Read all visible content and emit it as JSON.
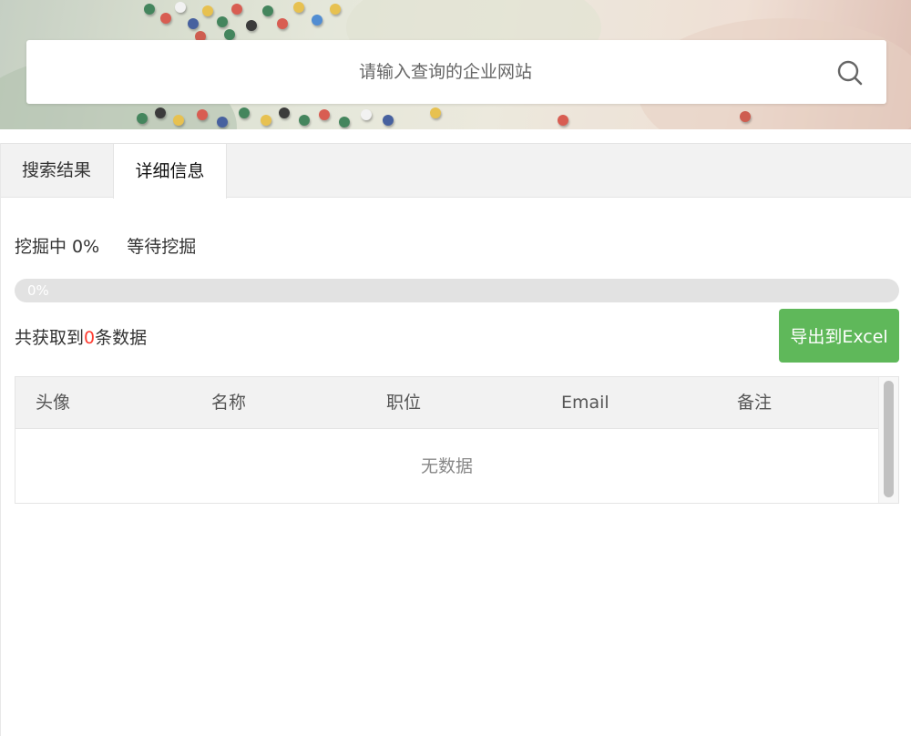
{
  "search": {
    "placeholder": "请输入查询的企业网站",
    "icon": "search-icon"
  },
  "tabs": [
    {
      "label": "搜索结果",
      "active": false
    },
    {
      "label": "详细信息",
      "active": true
    }
  ],
  "status": {
    "mining_label": "挖掘中 0%",
    "waiting_label": "等待挖掘"
  },
  "progress": {
    "value": 0,
    "label": "0%"
  },
  "summary": {
    "prefix": "共获取到",
    "count": "0",
    "suffix": "条数据"
  },
  "export": {
    "label": "导出到Excel"
  },
  "table": {
    "columns": [
      "头像",
      "名称",
      "职位",
      "Email",
      "备注"
    ],
    "rows": [],
    "empty_text": "无数据"
  },
  "colors": {
    "accent_green": "#5fb85a",
    "count_red": "#ff3b30",
    "tab_bar_bg": "#f2f2f2"
  }
}
